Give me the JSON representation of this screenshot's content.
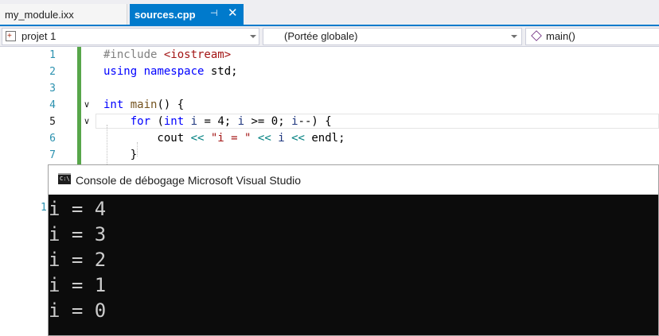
{
  "tabs": [
    {
      "label": "my_module.ixx",
      "active": false
    },
    {
      "label": "sources.cpp",
      "active": true
    }
  ],
  "icons": {
    "pin": "pin-icon",
    "close": "close-icon",
    "project": "project-icon",
    "member": "cube-icon",
    "console": "console-icon",
    "fold": "chevron-down-icon"
  },
  "navbar": {
    "project": "projet 1",
    "scope": "(Portée globale)",
    "member": "main()"
  },
  "editor": {
    "line_numbers": [
      "1",
      "2",
      "3",
      "4",
      "5",
      "6",
      "7"
    ],
    "current_line": "5",
    "lines": [
      [
        {
          "t": "#include ",
          "c": "pp"
        },
        {
          "t": "<iostream>",
          "c": "str"
        }
      ],
      [
        {
          "t": "using",
          "c": "kw"
        },
        {
          "t": " "
        },
        {
          "t": "namespace",
          "c": "kw"
        },
        {
          "t": " std;"
        }
      ],
      [],
      [
        {
          "t": "int",
          "c": "kw"
        },
        {
          "t": " "
        },
        {
          "t": "main",
          "c": "fn"
        },
        {
          "t": "() {"
        }
      ],
      [
        {
          "t": "    "
        },
        {
          "t": "for",
          "c": "kw"
        },
        {
          "t": " ("
        },
        {
          "t": "int",
          "c": "kw"
        },
        {
          "t": " "
        },
        {
          "t": "i",
          "c": "var"
        },
        {
          "t": " = 4; "
        },
        {
          "t": "i",
          "c": "var"
        },
        {
          "t": " >= 0; "
        },
        {
          "t": "i",
          "c": "var"
        },
        {
          "t": "--) {"
        }
      ],
      [
        {
          "t": "        cout "
        },
        {
          "t": "<<",
          "c": "op"
        },
        {
          "t": " "
        },
        {
          "t": "\"i = \"",
          "c": "str"
        },
        {
          "t": " "
        },
        {
          "t": "<<",
          "c": "op"
        },
        {
          "t": " "
        },
        {
          "t": "i",
          "c": "var"
        },
        {
          "t": " "
        },
        {
          "t": "<<",
          "c": "op"
        },
        {
          "t": " endl;"
        }
      ],
      [
        {
          "t": "    }"
        }
      ]
    ]
  },
  "console": {
    "title": "Console de débogage Microsoft Visual Studio",
    "icon_text": "C:\\",
    "output": [
      "i = 4",
      "i = 3",
      "i = 2",
      "i = 1",
      "i = 0"
    ],
    "stray_line_number": "1"
  },
  "colors": {
    "accent": "#007acc",
    "change_bar": "#57a64a",
    "keyword": "#0000ff",
    "string": "#a31515",
    "console_bg": "#0c0c0c"
  }
}
